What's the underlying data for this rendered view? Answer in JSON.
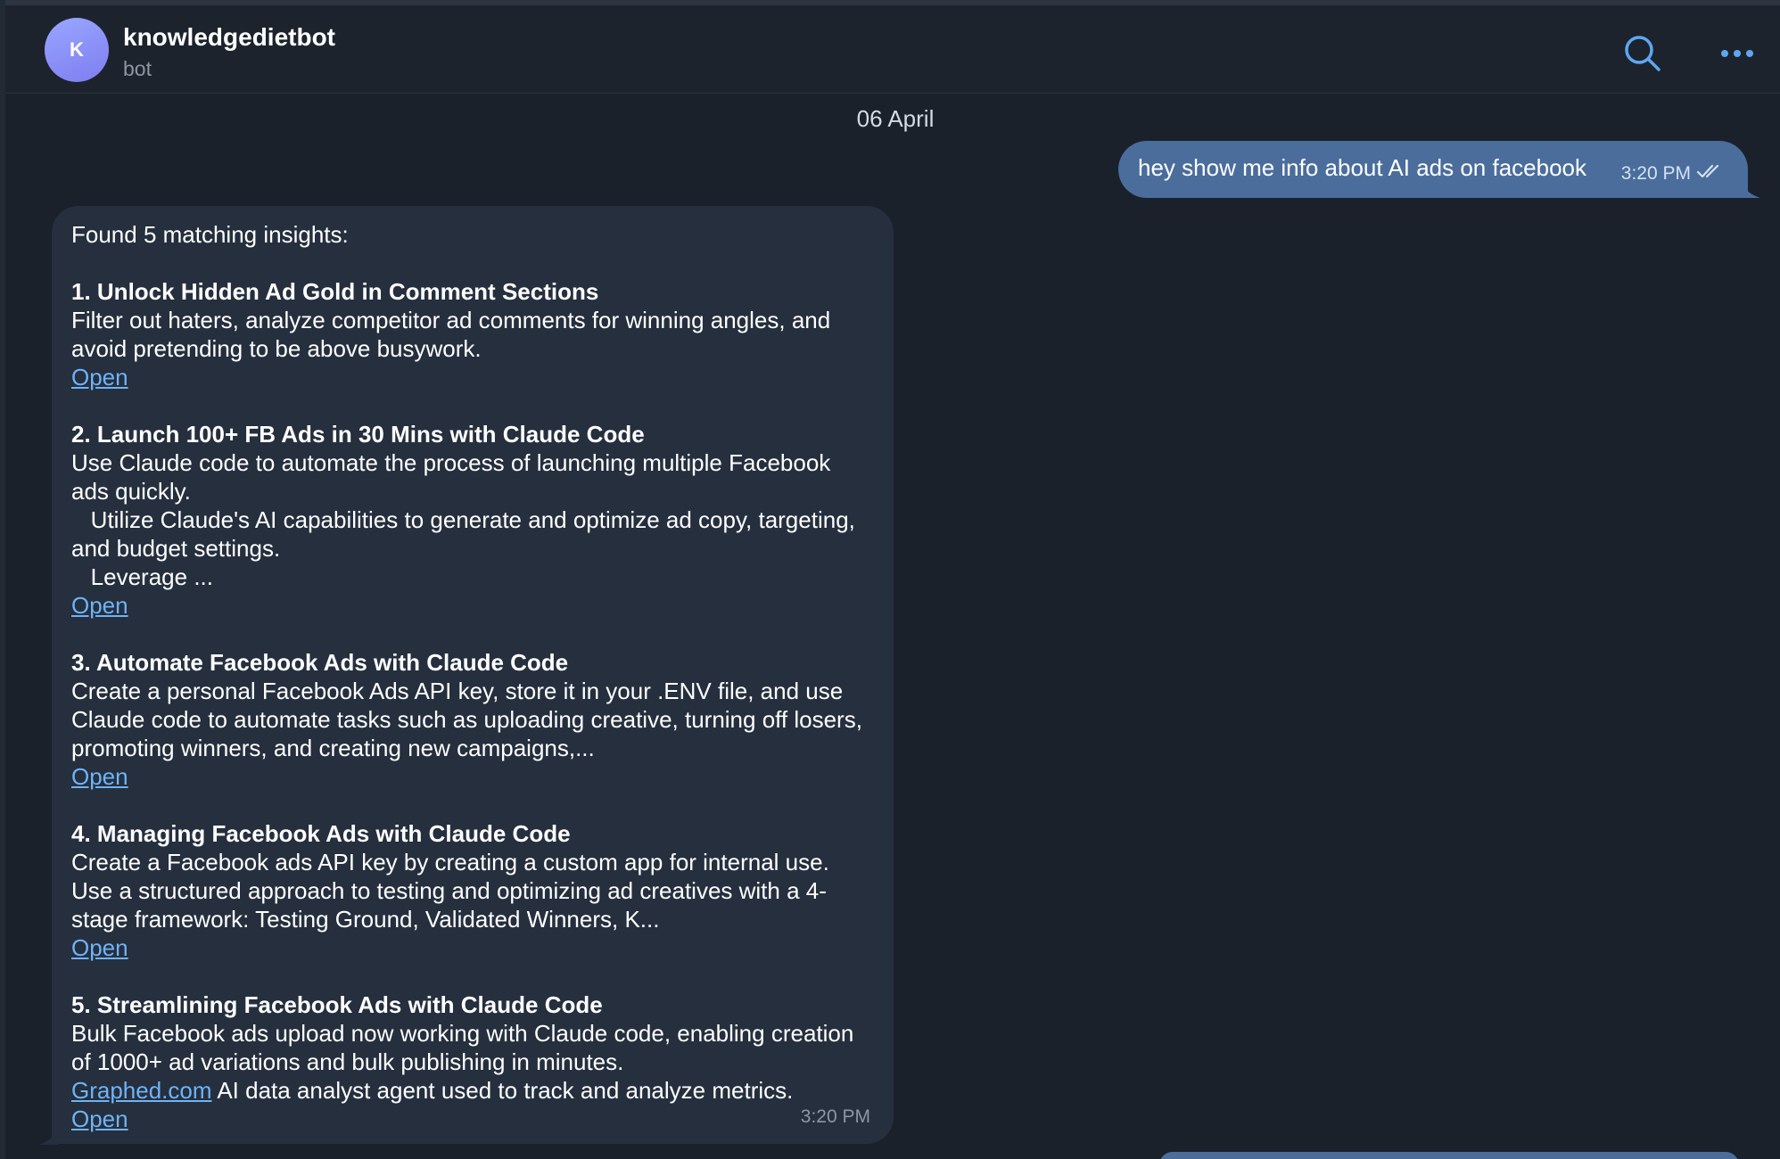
{
  "header": {
    "avatar_letter": "K",
    "chat_name": "knowledgedietbot",
    "chat_subtitle": "bot",
    "search_icon": "search-icon",
    "more_icon": "more-dots-icon"
  },
  "date_separator": "06 April",
  "outgoing_message": {
    "text": "hey show me info about AI ads on facebook",
    "time": "3:20 PM",
    "status_icon": "double-check-icon"
  },
  "incoming_message": {
    "intro": "Found 5 matching insights:",
    "items": [
      {
        "title": "1. Unlock Hidden Ad Gold in Comment Sections",
        "body": "Filter out haters, analyze competitor ad comments for winning angles, and avoid pretending to be above busywork.",
        "link": "Open"
      },
      {
        "title": "2. Launch 100+ FB Ads in 30 Mins with Claude Code",
        "body": "Use Claude code to automate the process of launching multiple Facebook ads quickly.\n   Utilize Claude's AI capabilities to generate and optimize ad copy, targeting, and budget settings.\n   Leverage ...",
        "link": "Open"
      },
      {
        "title": "3. Automate Facebook Ads with Claude Code",
        "body": "Create a personal Facebook Ads API key, store it in your .ENV file, and use Claude code to automate tasks such as uploading creative, turning off losers, promoting winners, and creating new campaigns,...",
        "link": "Open"
      },
      {
        "title": "4. Managing Facebook Ads with Claude Code",
        "body": "Create a Facebook ads API key by creating a custom app for internal use. Use a structured approach to testing and optimizing ad creatives with a 4-stage framework: Testing Ground, Validated Winners, K...",
        "link": "Open"
      },
      {
        "title": "5. Streamlining Facebook Ads with Claude Code",
        "body": "Bulk Facebook ads upload now working with Claude code, enabling creation of 1000+ ad variations and bulk publishing in minutes.",
        "inline_link": "Graphed.com",
        "inline_after": " AI data analyst agent used to track and analyze metrics.",
        "link": "Open"
      }
    ],
    "time": "3:20 PM"
  },
  "colors": {
    "background": "#1a212b",
    "outgoing_bubble": "#4a6d9c",
    "incoming_bubble": "#252f3e",
    "link": "#6fb3f5",
    "accent_icon": "#5ea7f0"
  }
}
